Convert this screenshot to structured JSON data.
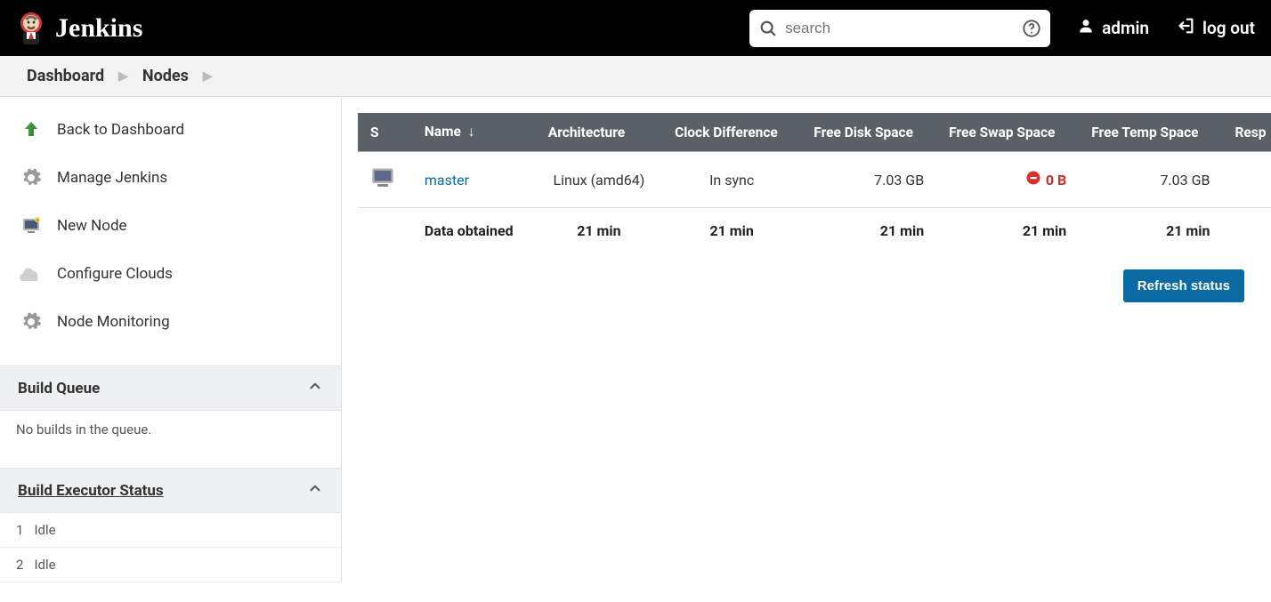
{
  "header": {
    "brand": "Jenkins",
    "search_placeholder": "search",
    "user": "admin",
    "logout": "log out"
  },
  "breadcrumb": [
    {
      "label": "Dashboard"
    },
    {
      "label": "Nodes"
    }
  ],
  "sidebar": {
    "tasks": [
      {
        "label": "Back to Dashboard",
        "icon": "up"
      },
      {
        "label": "Manage Jenkins",
        "icon": "gear"
      },
      {
        "label": "New Node",
        "icon": "computer"
      },
      {
        "label": "Configure Clouds",
        "icon": "cloud"
      },
      {
        "label": "Node Monitoring",
        "icon": "gear"
      }
    ],
    "build_queue": {
      "title": "Build Queue",
      "empty_text": "No builds in the queue."
    },
    "executors": {
      "title": "Build Executor Status",
      "rows": [
        {
          "index": "1",
          "state": "Idle"
        },
        {
          "index": "2",
          "state": "Idle"
        }
      ]
    }
  },
  "table": {
    "columns": {
      "status": "S",
      "name": "Name",
      "sort_arrow": "↓",
      "architecture": "Architecture",
      "clock": "Clock Difference",
      "disk": "Free Disk Space",
      "swap": "Free Swap Space",
      "temp": "Free Temp Space",
      "resp": "Resp"
    },
    "rows": [
      {
        "name": "master",
        "architecture": "Linux (amd64)",
        "clock": "In sync",
        "disk": "7.03 GB",
        "swap": "0 B",
        "swap_warn": true,
        "temp": "7.03 GB"
      }
    ],
    "summary": {
      "label": "Data obtained",
      "architecture": "21 min",
      "clock": "21 min",
      "disk": "21 min",
      "swap": "21 min",
      "temp": "21 min"
    },
    "refresh_button": "Refresh status"
  }
}
